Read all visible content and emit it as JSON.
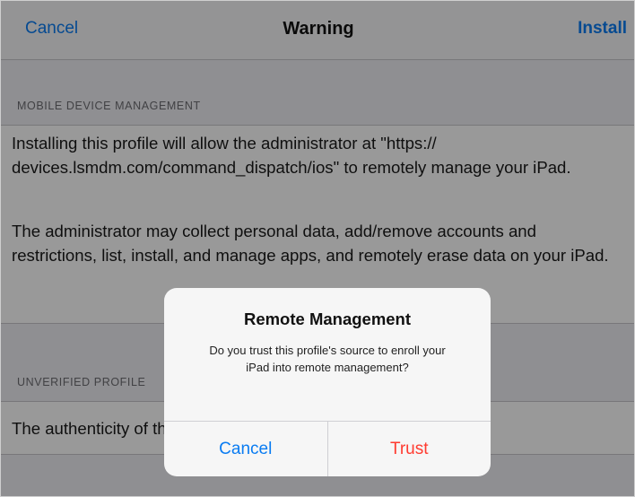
{
  "navbar": {
    "cancel_label": "Cancel",
    "title": "Warning",
    "install_label": "Install"
  },
  "sections": {
    "mdm_header": "MOBILE DEVICE MANAGEMENT",
    "mdm_paragraph_1": "Installing this profile will allow the administrator at \"https:// devices.lsmdm.com/command_dispatch/ios\" to remotely manage your iPad.",
    "mdm_paragraph_2": "The administrator may collect personal data, add/remove accounts and restrictions, list, install, and manage apps, and remotely erase data on your iPad.",
    "unverified_header": "UNVERIFIED PROFILE",
    "unverified_paragraph": "The authenticity of this profile cannot be verified."
  },
  "alert": {
    "title": "Remote Management",
    "message": "Do you trust this profile's source to enroll your iPad into remote management?",
    "cancel_label": "Cancel",
    "trust_label": "Trust"
  },
  "colors": {
    "accent_blue": "#0a7cf2",
    "destructive_red": "#ff3b30",
    "background": "#efeff4"
  }
}
